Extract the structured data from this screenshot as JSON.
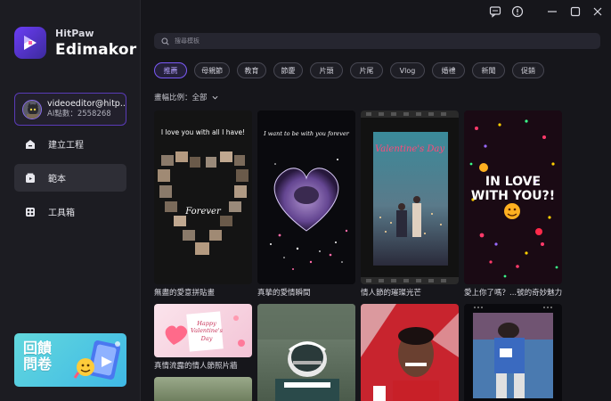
{
  "window": {
    "icons": [
      "chat-icon",
      "info-icon",
      "minimize-icon",
      "maximize-icon",
      "close-icon"
    ]
  },
  "brand": {
    "sub": "HitPaw",
    "name": "Edimakor"
  },
  "user": {
    "name": "videoeditor@hitp...",
    "points": "AI點數：2558268"
  },
  "nav": {
    "create": "建立工程",
    "template": "範本",
    "toolbox": "工具箱"
  },
  "promo": {
    "line1": "回饋",
    "line2": "問卷"
  },
  "search": {
    "placeholder": "搜尋模板"
  },
  "tags": [
    "推薦",
    "母親節",
    "教育",
    "節慶",
    "片頭",
    "片尾",
    "Vlog",
    "婚禮",
    "新聞",
    "促銷"
  ],
  "ratio": {
    "label": "畫幅比例：全部"
  },
  "templates": [
    {
      "caption": "無盡的愛意拼貼畫",
      "text": "I love you with all I have!",
      "text2": "Forever"
    },
    {
      "caption": "真摯的愛情瞬間",
      "text": "I want to be with you forever"
    },
    {
      "caption": "情人節的璀璨光芒",
      "text": "Valentine's Day"
    },
    {
      "caption": "愛上你了嗎？...號的奇妙魅力",
      "text": "IN LOVE WITH YOU?!"
    },
    {
      "caption": "真情流露的情人節照片牆",
      "text": "Happy Valentine's Day"
    },
    {
      "caption": ""
    },
    {
      "caption": ""
    },
    {
      "caption": ""
    }
  ],
  "colors": {
    "accent": "#7b5af7",
    "background": "#16161b",
    "sidebar": "#1c1c22"
  }
}
